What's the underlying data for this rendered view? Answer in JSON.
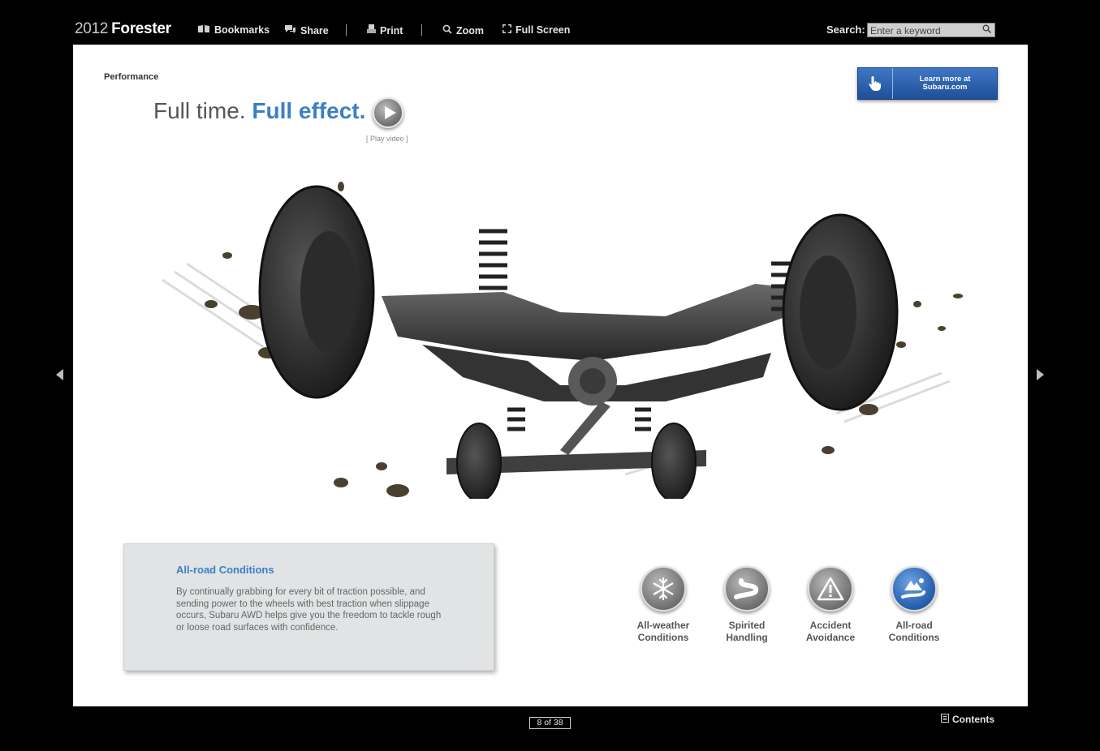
{
  "header": {
    "brand_year": "2012",
    "brand_name": "Forester",
    "nav": {
      "bookmarks": "Bookmarks",
      "share": "Share",
      "print": "Print",
      "zoom": "Zoom",
      "fullscreen": "Full Screen"
    },
    "search": {
      "label": "Search:",
      "placeholder": "Enter a keyword"
    }
  },
  "page": {
    "section": "Performance",
    "headline_regular": "Full time.",
    "headline_bold": "Full effect.",
    "play_caption": "[ Play video ]",
    "learn_more": "Learn more at\nSubaru.com",
    "info": {
      "title": "All-road Conditions",
      "body": "By continually grabbing for every bit of traction possible, and sending power to the wheels with best traction when slippage occurs, Subaru AWD helps give you the freedom to tackle rough or loose road surfaces with confidence."
    },
    "features": [
      {
        "label": "All-weather\nConditions",
        "icon": "snowflake-icon"
      },
      {
        "label": "Spirited\nHandling",
        "icon": "curved-road-icon"
      },
      {
        "label": "Accident\nAvoidance",
        "icon": "warning-icon"
      },
      {
        "label": "All-road\nConditions",
        "icon": "mountain-road-icon"
      }
    ]
  },
  "footer": {
    "page_indicator": "8 of 38",
    "contents": "Contents"
  },
  "colors": {
    "accent_blue": "#3b7fc4",
    "background": "#000000"
  }
}
